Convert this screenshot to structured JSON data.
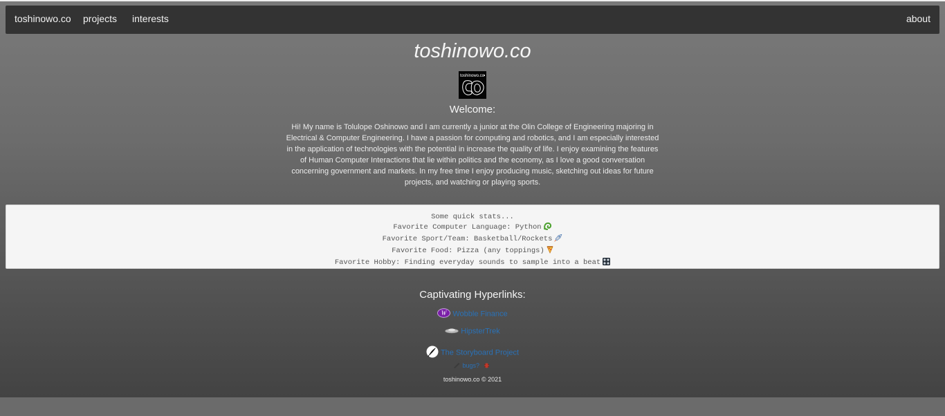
{
  "nav": {
    "brand": "toshinowo.co",
    "projects": "projects",
    "interests": "interests",
    "about": "about"
  },
  "header": {
    "title": "toshinowo.co",
    "logo_text": "toshinowo.co",
    "logo_mark": "CO"
  },
  "welcome": {
    "heading": "Welcome:",
    "bio": "Hi! My name is Tolulope Oshinowo and I am currently a junior at the Olin College of Engineering majoring in Electrical & Computer Engineering. I have a passion for computing and robotics, and I am especially interested in the application of technologies with the potential in increase the quality of life. I enjoy examining the features of Human Computer Interactions that lie within politics and the economy, as I love a good conversation concerning government and markets. In my free time I enjoy producing music, sketching out ideas for future projects, and watching or playing sports."
  },
  "stats": {
    "intro": "Some quick stats...",
    "language": "Favorite Computer Language: Python",
    "language_icon": "snake-icon",
    "sport": "Favorite Sport/Team: Basketball/Rockets",
    "sport_icon": "rocket-icon",
    "food": "Favorite Food: Pizza (any toppings)",
    "food_icon": "pizza-icon",
    "hobby": "Favorite Hobby: Finding everyday sounds to sample into a beat",
    "hobby_icon": "control-knobs-icon"
  },
  "links": {
    "heading": "Captivating Hyperlinks:",
    "items": [
      {
        "label": "Wobble Finance",
        "icon": "wobble-logo-icon",
        "icon_letter": "W",
        "color": "#8e2fb8"
      },
      {
        "label": "HipsterTrek",
        "icon": "hipstertrek-icon"
      },
      {
        "label": "The Storyboard Project",
        "icon": "storyboard-icon"
      }
    ],
    "bugs": "bugs?"
  },
  "footer": {
    "text": "toshinowo.co © 2021"
  },
  "colors": {
    "navbar": "#333333",
    "link": "#2a72b8",
    "stats_bg": "#f5f5f5"
  }
}
